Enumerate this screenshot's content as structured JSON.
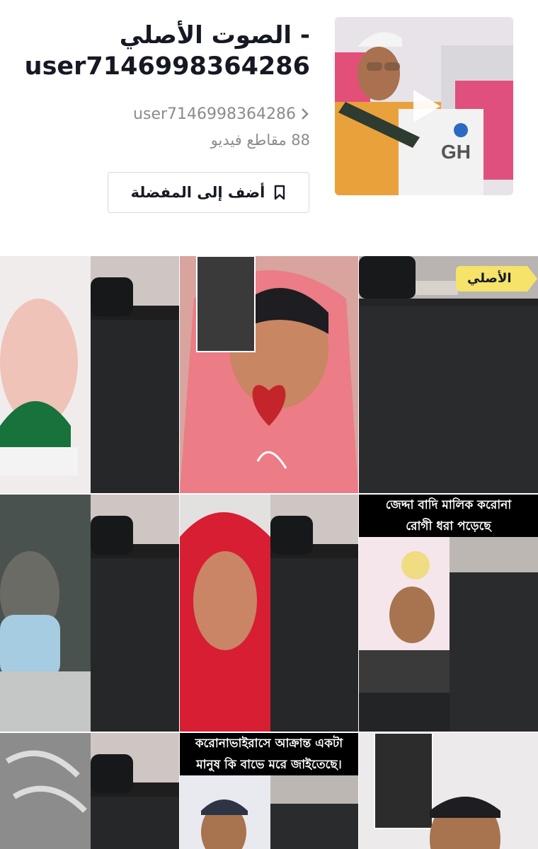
{
  "sound": {
    "title_line1": "الصوت الأصلي -",
    "title_line2": "user7146998364286",
    "author": "user7146998364286",
    "video_count": "88 مقاطع فيديو",
    "add_favorite_label": "أضف إلى المفضلة"
  },
  "grid": {
    "original_badge": "الأصلي",
    "captions": {
      "c6_line1": "জেদ্দা বাদি মালিক করোনা",
      "c6_line2": "রোগী ধরা পড়েছে",
      "c8_line1": "করোনাভাইরাসে আক্রান্ত একটা",
      "c8_line2": "মানুষ কি বাভে মরে জাইতেছে।"
    }
  },
  "colors": {
    "title": "#161823",
    "muted": "#8a8b91",
    "badge": "#f5e36a",
    "border": "#d8d9dc"
  }
}
